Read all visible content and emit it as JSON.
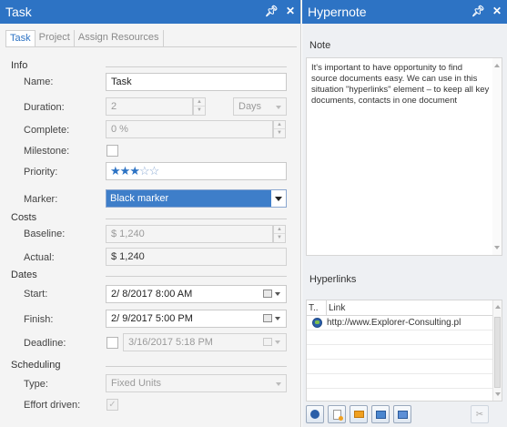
{
  "task": {
    "title": "Task",
    "pin_icon": "pin-icon",
    "close_icon": "close-icon",
    "tabs": [
      "Task",
      "Project",
      "Assign Resources"
    ],
    "sections": {
      "info": "Info",
      "costs": "Costs",
      "dates": "Dates",
      "scheduling": "Scheduling"
    },
    "labels": {
      "name": "Name:",
      "duration": "Duration:",
      "complete": "Complete:",
      "milestone": "Milestone:",
      "priority": "Priority:",
      "marker": "Marker:",
      "baseline": "Baseline:",
      "actual": "Actual:",
      "start": "Start:",
      "finish": "Finish:",
      "deadline": "Deadline:",
      "type": "Type:",
      "effort_driven": "Effort driven:"
    },
    "values": {
      "name": "Task",
      "duration": "2",
      "duration_unit": "Days",
      "complete": "0 %",
      "milestone_checked": false,
      "priority_stars_filled": 3,
      "priority_stars_total": 5,
      "marker": "Black marker",
      "baseline": "$ 1,240",
      "actual": "$ 1,240",
      "start": "2/  8/2017   8:00 AM",
      "finish": "2/  9/2017   5:00 PM",
      "deadline": "3/16/2017   5:18 PM",
      "deadline_checked": false,
      "type": "Fixed Units",
      "effort_driven_checked": true
    }
  },
  "hypernote": {
    "title": "Hypernote",
    "pin_icon": "pin-icon",
    "close_icon": "close-icon",
    "note_label": "Note",
    "note_text": "It's important to have opportunity to find source documents easy. We can use in this situation \"hyperlinks\" element – to keep all key documents, contacts in one document",
    "hyperlinks_label": "Hyperlinks",
    "grid_headers": [
      "T..",
      "Link"
    ],
    "links": [
      {
        "icon": "globe-icon",
        "link": "http://www.Explorer-Consulting.pl"
      }
    ],
    "toolbar": [
      "add-web-link-icon",
      "add-document-icon",
      "add-folder-icon",
      "add-screen-icon",
      "edit-link-icon",
      "remove-link-icon"
    ]
  },
  "colors": {
    "title_bar": "#2d73c4",
    "selection": "#3e7ec9",
    "star": "#2d73c4"
  }
}
